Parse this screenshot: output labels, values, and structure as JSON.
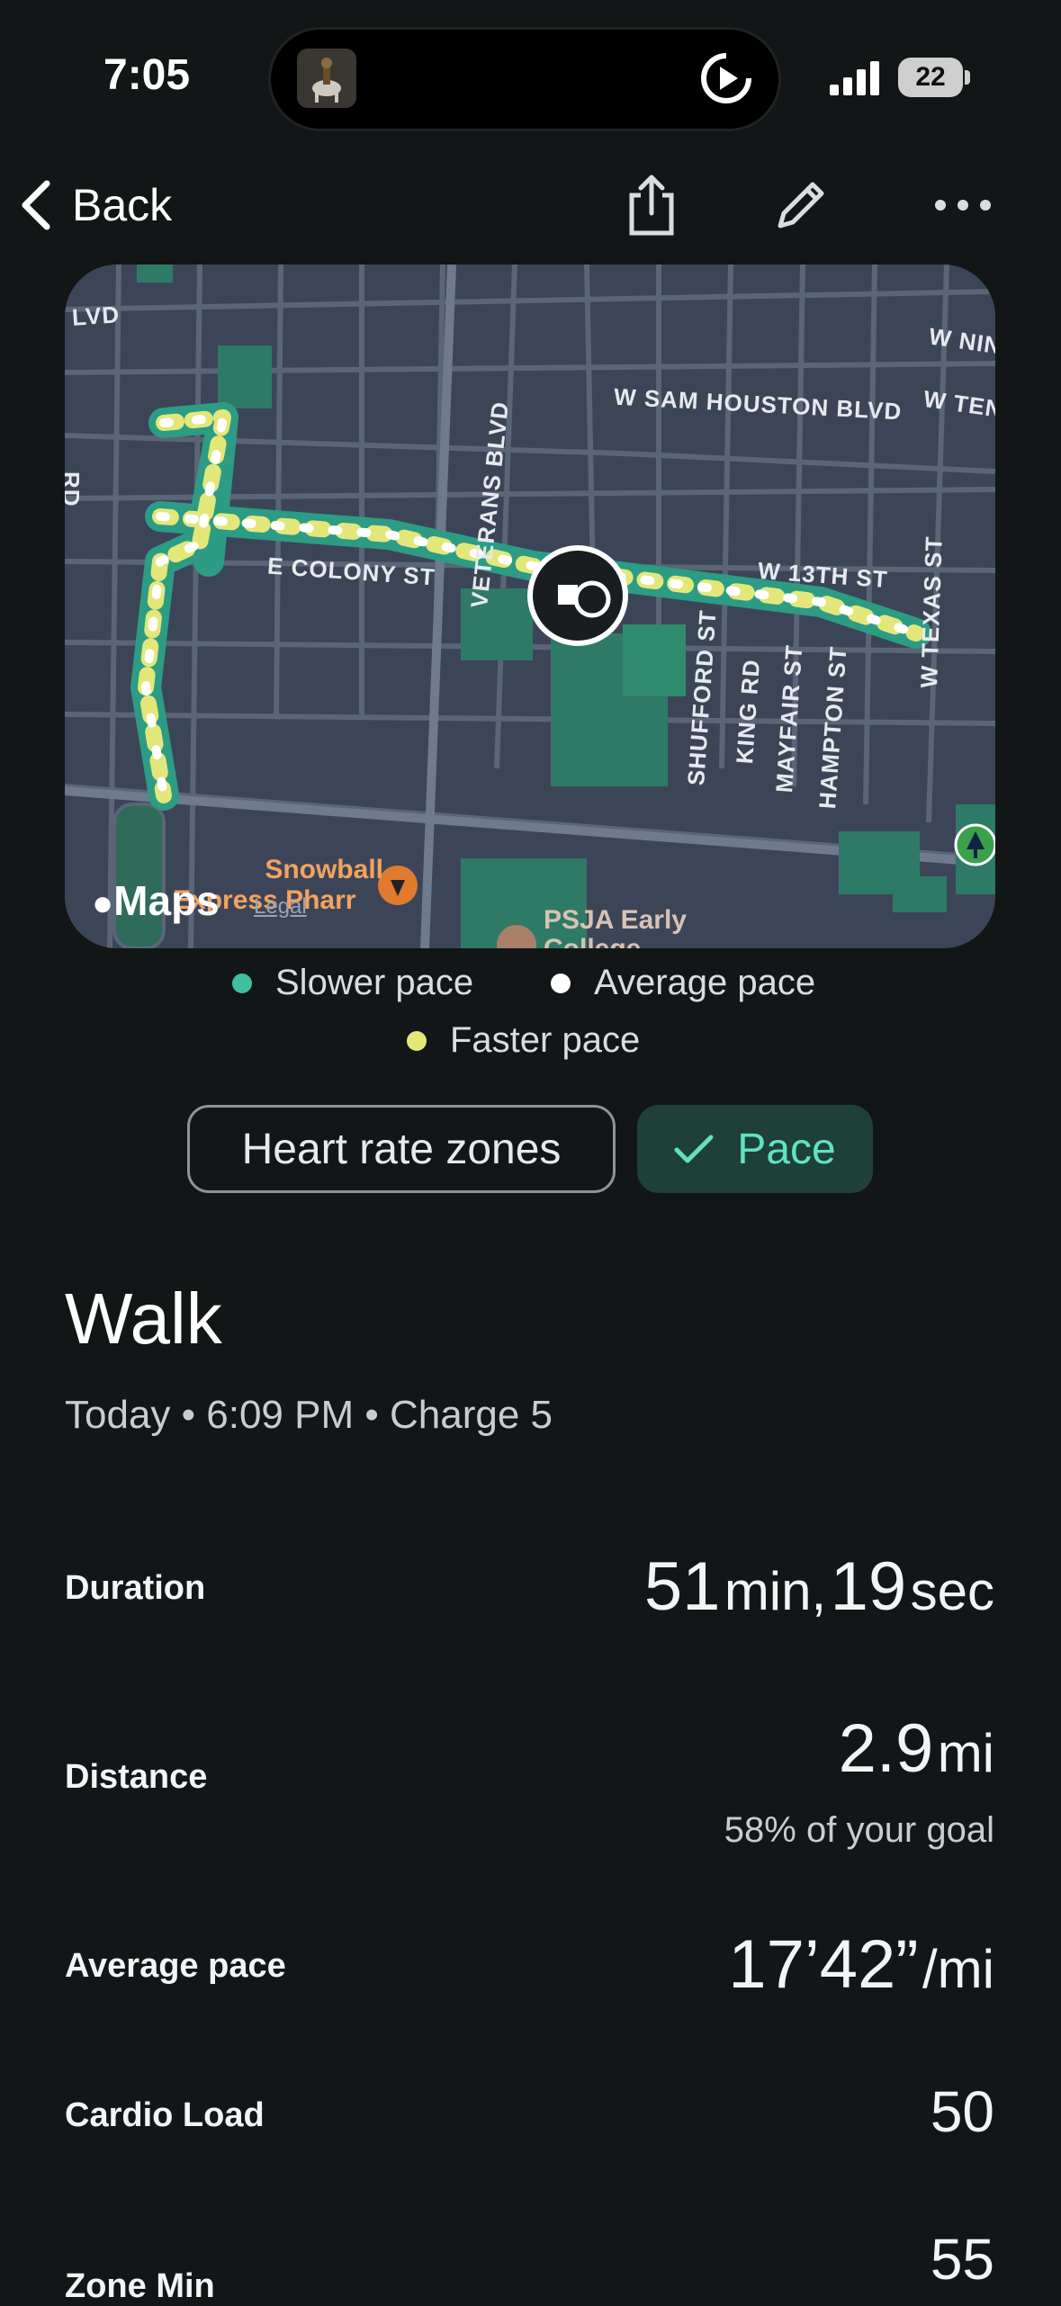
{
  "status_bar": {
    "time": "7:05",
    "battery": "22"
  },
  "header": {
    "back_label": "Back"
  },
  "map": {
    "streets": [
      "W SAM HOUSTON BLVD",
      "W 13TH ST",
      "W TEXAS ST",
      "SHUFFORD ST",
      "KING RD",
      "MAYFAIR ST",
      "HAMPTON ST",
      "E COLONY ST",
      "VETERANS BLVD",
      "W NIN",
      "W TEN",
      "LVD",
      "RD"
    ],
    "pois": [
      "Snowball",
      "Express Pharr",
      "PSJA Early",
      "College"
    ],
    "attribution": "Maps",
    "legal": "Legal"
  },
  "legend": {
    "slower": "Slower pace",
    "average": "Average pace",
    "faster": "Faster pace",
    "colors": {
      "slower": "#3fbfa0",
      "average": "#ffffff",
      "faster": "#e3e77a"
    }
  },
  "toggles": {
    "heart_rate": "Heart rate zones",
    "pace": "Pace"
  },
  "activity": {
    "title": "Walk",
    "subtitle": "Today • 6:09 PM • Charge 5"
  },
  "stats": {
    "duration": {
      "label": "Duration",
      "min": "51",
      "min_unit": "min,",
      "sec": "19",
      "sec_unit": "sec"
    },
    "distance": {
      "label": "Distance",
      "value": "2.9",
      "unit": "mi",
      "note": "58% of your goal"
    },
    "pace": {
      "label": "Average pace",
      "value": "17’42”",
      "unit": "/mi"
    },
    "cardio": {
      "label": "Cardio Load",
      "value": "50"
    },
    "zone": {
      "label": "Zone Min",
      "value": "55"
    }
  }
}
